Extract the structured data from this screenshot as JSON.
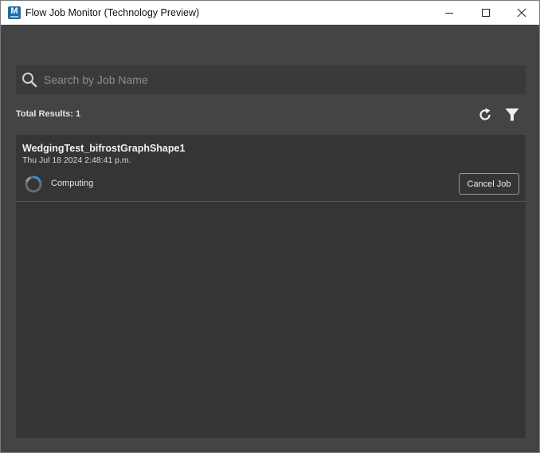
{
  "window": {
    "title": "Flow Job Monitor (Technology Preview)",
    "app_icon_letter": "M",
    "controls": [
      "minimize-icon",
      "maximize-icon",
      "close-icon"
    ]
  },
  "search": {
    "placeholder": "Search by Job Name",
    "value": "",
    "icon": "search-icon"
  },
  "results": {
    "total_label": "Total Results: 1",
    "refresh_icon": "refresh-icon",
    "filter_icon": "filter-icon"
  },
  "jobs": [
    {
      "name": "WedgingTest_bifrostGraphShape1",
      "date": "Thu Jul 18 2024 2:48:41 p.m.",
      "status": "Computing",
      "status_icon": "spinner-icon",
      "action_label": "Cancel Job"
    }
  ],
  "colors": {
    "background": "#454545",
    "panel": "#353535",
    "search_bg": "#3a3a3a",
    "spinner_accent": "#3d8fd1",
    "titlebar": "#ffffff"
  }
}
